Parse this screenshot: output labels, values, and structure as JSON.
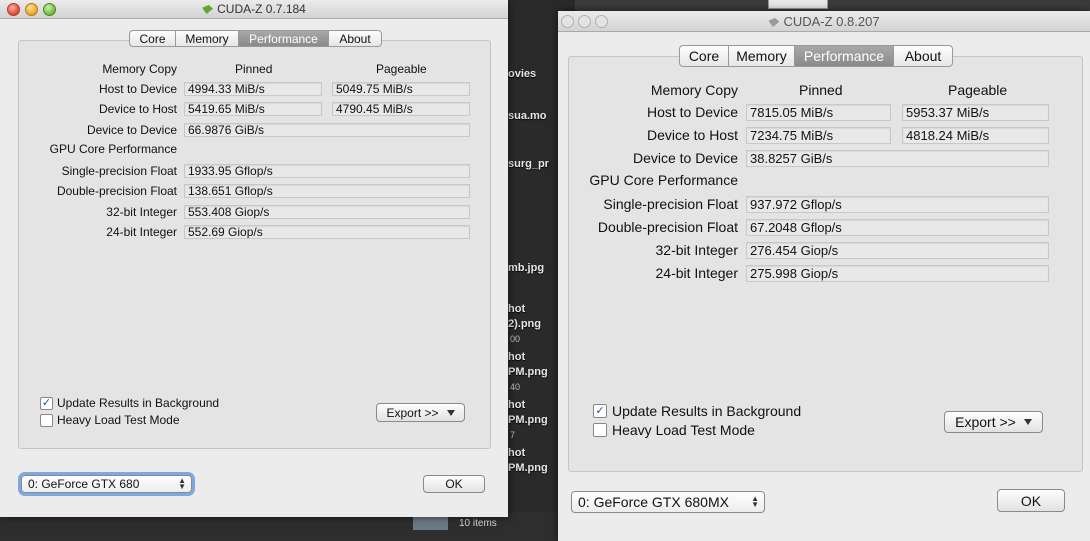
{
  "background": {
    "finder_items": [
      {
        "name": "ovies",
        "sub": ""
      },
      {
        "name": "sua.mo",
        "sub": ""
      },
      {
        "name": "surg_pr",
        "sub": ""
      },
      {
        "name": "mb.jpg",
        "sub": ""
      },
      {
        "name": "hot",
        "sub": ""
      },
      {
        "name": "2).png",
        "sub": "00"
      },
      {
        "name": "hot",
        "sub": ""
      },
      {
        "name": "PM.png",
        "sub": "40"
      },
      {
        "name": "hot",
        "sub": ""
      },
      {
        "name": "PM.png",
        "sub": "7"
      },
      {
        "name": "hot",
        "sub": ""
      },
      {
        "name": "PM.png",
        "sub": ""
      }
    ],
    "items_count": "10 items"
  },
  "win1": {
    "title": "CUDA-Z 0.7.184",
    "tabs": [
      "Core",
      "Memory",
      "Performance",
      "About"
    ],
    "active_tab": "Performance",
    "memory_copy_label": "Memory Copy",
    "pinned_label": "Pinned",
    "pageable_label": "Pageable",
    "h2d_label": "Host to Device",
    "h2d_pinned": "4994.33 MiB/s",
    "h2d_pageable": "5049.75 MiB/s",
    "d2h_label": "Device to Host",
    "d2h_pinned": "5419.65 MiB/s",
    "d2h_pageable": "4790.45 MiB/s",
    "d2d_label": "Device to Device",
    "d2d_value": "66.9876 GiB/s",
    "gpu_core_label": "GPU Core Performance",
    "sp_label": "Single-precision Float",
    "sp_value": "1933.95 Gflop/s",
    "dp_label": "Double-precision Float",
    "dp_value": "138.651 Gflop/s",
    "i32_label": "32-bit Integer",
    "i32_value": "553.408 Giop/s",
    "i24_label": "24-bit Integer",
    "i24_value": "552.69 Giop/s",
    "update_bg_label": "Update Results in Background",
    "update_bg_checked": "✓",
    "heavy_label": "Heavy Load Test Mode",
    "export_label": "Export >>",
    "device_select": "0: GeForce GTX 680",
    "ok_label": "OK"
  },
  "win2": {
    "title": "CUDA-Z 0.8.207",
    "tabs": [
      "Core",
      "Memory",
      "Performance",
      "About"
    ],
    "active_tab": "Performance",
    "memory_copy_label": "Memory Copy",
    "pinned_label": "Pinned",
    "pageable_label": "Pageable",
    "h2d_label": "Host to Device",
    "h2d_pinned": "7815.05 MiB/s",
    "h2d_pageable": "5953.37 MiB/s",
    "d2h_label": "Device to Host",
    "d2h_pinned": "7234.75 MiB/s",
    "d2h_pageable": "4818.24 MiB/s",
    "d2d_label": "Device to Device",
    "d2d_value": "38.8257 GiB/s",
    "gpu_core_label": "GPU Core Performance",
    "sp_label": "Single-precision Float",
    "sp_value": "937.972 Gflop/s",
    "dp_label": "Double-precision Float",
    "dp_value": "67.2048 Gflop/s",
    "i32_label": "32-bit Integer",
    "i32_value": "276.454 Giop/s",
    "i24_label": "24-bit Integer",
    "i24_value": "275.998 Giop/s",
    "update_bg_label": "Update Results in Background",
    "update_bg_checked": "✓",
    "heavy_label": "Heavy Load Test Mode",
    "export_label": "Export >>",
    "device_select": "0: GeForce GTX 680MX",
    "ok_label": "OK"
  }
}
